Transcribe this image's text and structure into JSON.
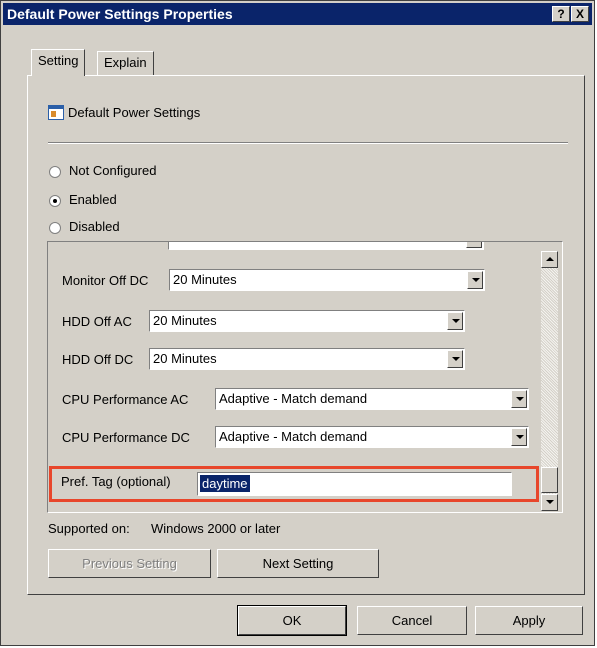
{
  "window": {
    "title": "Default Power Settings Properties",
    "help_label": "?",
    "close_label": "X"
  },
  "tabs": [
    {
      "label": "Setting",
      "active": true
    },
    {
      "label": "Explain",
      "active": false
    }
  ],
  "policy": {
    "icon": "policy-setting-icon",
    "name": "Default Power Settings"
  },
  "options": [
    {
      "label": "Not Configured",
      "selected": false
    },
    {
      "label": "Enabled",
      "selected": true
    },
    {
      "label": "Disabled",
      "selected": false
    }
  ],
  "settings": [
    {
      "label": "Monitor Off DC",
      "value": "20 Minutes"
    },
    {
      "label": "HDD Off AC",
      "value": "20 Minutes"
    },
    {
      "label": "HDD Off DC",
      "value": "20 Minutes"
    },
    {
      "label": "CPU Performance AC",
      "value": "Adaptive - Match demand"
    },
    {
      "label": "CPU Performance DC",
      "value": "Adaptive - Match demand"
    }
  ],
  "pref_tag": {
    "label": "Pref. Tag (optional)",
    "value": "daytime"
  },
  "supported": {
    "label": "Supported on:",
    "value": "Windows 2000 or later"
  },
  "nav": {
    "previous": "Previous Setting",
    "next": "Next Setting"
  },
  "buttons": {
    "ok": "OK",
    "cancel": "Cancel",
    "apply": "Apply"
  },
  "colors": {
    "titlebar": "#0a246a",
    "highlight": "#e8462b",
    "face": "#d4d0c8"
  }
}
